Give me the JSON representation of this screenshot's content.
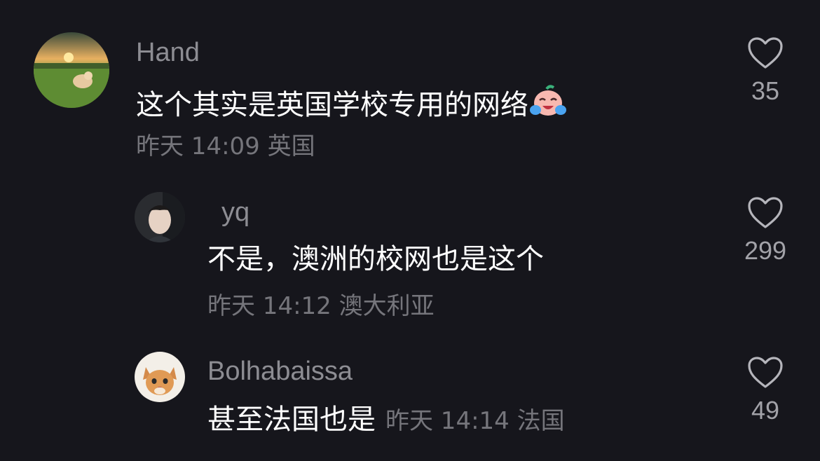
{
  "comments": [
    {
      "username": "Hand",
      "text": "这个其实是英国学校专用的网络",
      "emoji": "crying-laughing-emoji",
      "time": "昨天 14:09 英国",
      "likes": "35"
    },
    {
      "username": "yq",
      "text": "不是，澳洲的校网也是这个",
      "time": "昨天 14:12 澳大利亚",
      "likes": "299"
    },
    {
      "username": "Bolhabaissa",
      "text": "甚至法国也是",
      "time": "昨天 14:14 法国",
      "likes": "49"
    }
  ],
  "colors": {
    "background": "#16161c",
    "username": "#8d8d93",
    "meta": "#75757b",
    "text": "#ffffff",
    "like_icon": "#b5b5bb"
  }
}
